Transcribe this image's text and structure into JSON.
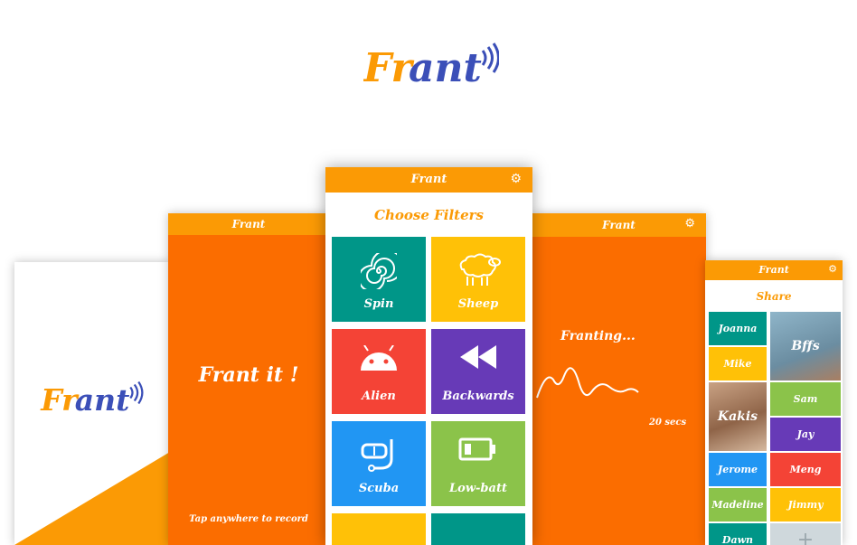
{
  "brand": {
    "name": "Frant",
    "orange": "#fb9a05",
    "blue": "#3b4fb8"
  },
  "screen_splash": {},
  "screen_record": {
    "header_title": "Frant",
    "headline": "Frant it !",
    "hint": "Tap anywhere to record"
  },
  "screen_filters": {
    "header_title": "Frant",
    "heading": "Choose Filters",
    "tiles": [
      {
        "label": "Spin",
        "icon": "spiral-icon",
        "color": "#009688"
      },
      {
        "label": "Sheep",
        "icon": "sheep-icon",
        "color": "#ffc107"
      },
      {
        "label": "Alien",
        "icon": "android-icon",
        "color": "#f44336"
      },
      {
        "label": "Backwards",
        "icon": "rewind-icon",
        "color": "#673ab7"
      },
      {
        "label": "Scuba",
        "icon": "snorkel-mask-icon",
        "color": "#2196f3"
      },
      {
        "label": "Low-batt",
        "icon": "low-battery-icon",
        "color": "#8bc34a"
      }
    ]
  },
  "screen_processing": {
    "header_title": "Frant",
    "status": "Franting...",
    "timer": "20 secs"
  },
  "screen_share": {
    "header_title": "Frant",
    "heading": "Share",
    "contacts": [
      {
        "name": "Joanna",
        "color": "#009688"
      },
      {
        "name": "Mike",
        "color": "#ffc107"
      },
      {
        "name": "Bffs",
        "color": "#7a9fb3"
      },
      {
        "name": "Kakis",
        "color": "#b48a6c"
      },
      {
        "name": "Sam",
        "color": "#8bc34a"
      },
      {
        "name": "Jay",
        "color": "#673ab7"
      },
      {
        "name": "Jerome",
        "color": "#2196f3"
      },
      {
        "name": "Meng",
        "color": "#f44336"
      },
      {
        "name": "Madeline",
        "color": "#8bc34a"
      },
      {
        "name": "Jimmy",
        "color": "#ffc107"
      },
      {
        "name": "Dawn",
        "color": "#009688"
      },
      {
        "name": "+",
        "color": "#cfd8dc"
      }
    ]
  }
}
